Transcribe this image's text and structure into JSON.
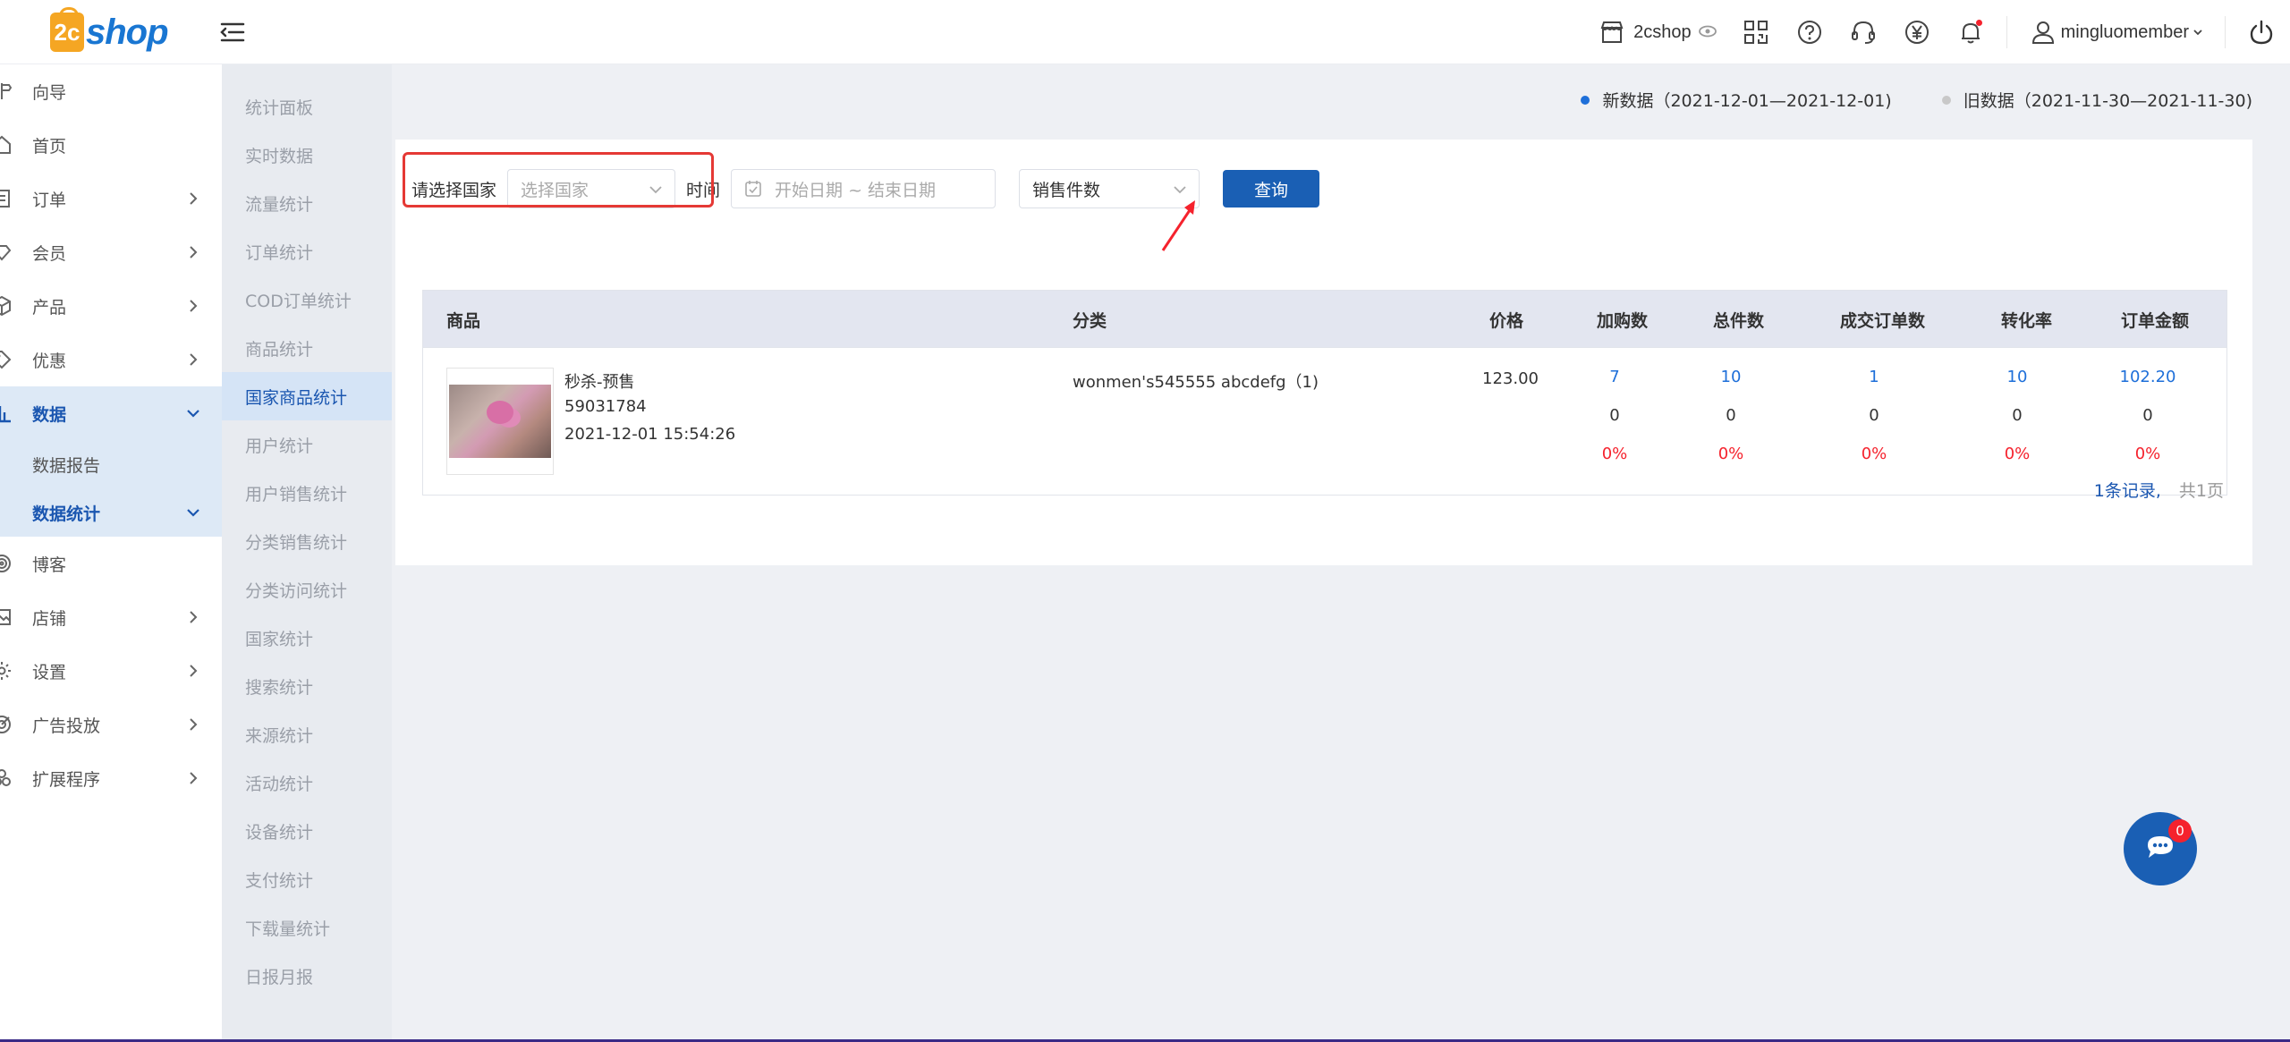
{
  "header": {
    "logo_text": "shop",
    "logo_mark": "2c",
    "store_name": "2cshop",
    "username": "mingluomember"
  },
  "sidebar": {
    "items": [
      {
        "label": "向导",
        "icon": "guide-icon"
      },
      {
        "label": "首页",
        "icon": "home-icon"
      },
      {
        "label": "订单",
        "icon": "order-icon"
      },
      {
        "label": "会员",
        "icon": "member-icon"
      },
      {
        "label": "产品",
        "icon": "product-icon"
      },
      {
        "label": "优惠",
        "icon": "coupon-icon"
      },
      {
        "label": "数据",
        "icon": "chart-icon"
      },
      {
        "label": "博客",
        "icon": "blog-icon"
      },
      {
        "label": "店铺",
        "icon": "store-icon"
      },
      {
        "label": "设置",
        "icon": "settings-icon"
      },
      {
        "label": "广告投放",
        "icon": "ads-icon"
      },
      {
        "label": "扩展程序",
        "icon": "extension-icon"
      }
    ],
    "data_sub": [
      "数据报告",
      "数据统计"
    ]
  },
  "subnav": {
    "items": [
      "统计面板",
      "实时数据",
      "流量统计",
      "订单统计",
      "COD订单统计",
      "商品统计",
      "国家商品统计",
      "用户统计",
      "用户销售统计",
      "分类销售统计",
      "分类访问统计",
      "国家统计",
      "搜索统计",
      "来源统计",
      "活动统计",
      "设备统计",
      "支付统计",
      "下载量统计",
      "日报月报"
    ],
    "active_index": 6
  },
  "legend": {
    "new": "新数据（2021-12-01—2021-12-01)",
    "old": "旧数据（2021-11-30—2021-11-30)",
    "new_color": "#1e6fd9",
    "old_color": "#c8c8c8"
  },
  "filters": {
    "country_label": "请选择国家",
    "country_placeholder": "选择国家",
    "time_label": "时间",
    "date_placeholder": "开始日期 ~ 结束日期",
    "sort_value": "销售件数",
    "query_button": "查询"
  },
  "table": {
    "headers": [
      "商品",
      "分类",
      "价格",
      "加购数",
      "总件数",
      "成交订单数",
      "转化率",
      "订单金额"
    ],
    "rows": [
      {
        "name": "秒杀-预售",
        "id": "59031784",
        "date": "2021-12-01 15:54:26",
        "category": "wonmen's545555 abcdefg（1)",
        "price": "123.00",
        "cart": [
          "7",
          "0",
          "0%"
        ],
        "total": [
          "10",
          "0",
          "0%"
        ],
        "orders": [
          "1",
          "0",
          "0%"
        ],
        "conversion": [
          "10",
          "0",
          "0%"
        ],
        "amount": [
          "102.20",
          "0",
          "0%"
        ]
      }
    ]
  },
  "pager": {
    "total": "1条记录,",
    "pages": "共1页"
  },
  "chat": {
    "badge": "0"
  }
}
